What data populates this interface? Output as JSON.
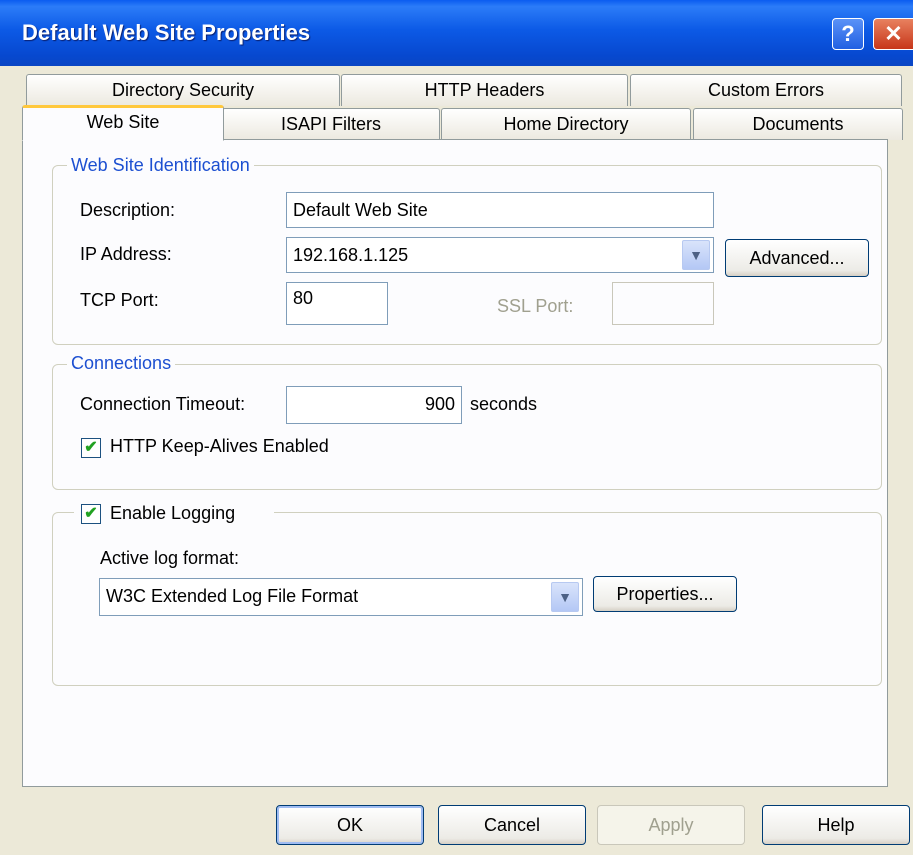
{
  "window": {
    "title": "Default Web Site Properties",
    "help_glyph": "?",
    "close_glyph": "✕"
  },
  "tabs": {
    "row1": [
      "Directory Security",
      "HTTP Headers",
      "Custom Errors"
    ],
    "row2": [
      "Web Site",
      "ISAPI Filters",
      "Home Directory",
      "Documents"
    ],
    "active": "Web Site"
  },
  "identification": {
    "legend": "Web Site Identification",
    "description_label": "Description:",
    "description_value": "Default Web Site",
    "ip_label": "IP Address:",
    "ip_value": "192.168.1.125",
    "advanced_button": "Advanced...",
    "tcp_label": "TCP Port:",
    "tcp_value": "80",
    "ssl_label": "SSL Port:",
    "ssl_value": ""
  },
  "connections": {
    "legend": "Connections",
    "timeout_label": "Connection Timeout:",
    "timeout_value": "900",
    "timeout_unit": "seconds",
    "keepalive_label": "HTTP Keep-Alives Enabled",
    "keepalive_checked": true
  },
  "logging": {
    "enable_label": "Enable Logging",
    "enable_checked": true,
    "format_label": "Active log format:",
    "format_value": "W3C Extended Log File Format",
    "properties_button": "Properties..."
  },
  "buttons": {
    "ok": "OK",
    "cancel": "Cancel",
    "apply": "Apply",
    "help": "Help"
  },
  "icons": {
    "dropdown": "chevron-down-icon",
    "check": "checkmark-icon"
  }
}
